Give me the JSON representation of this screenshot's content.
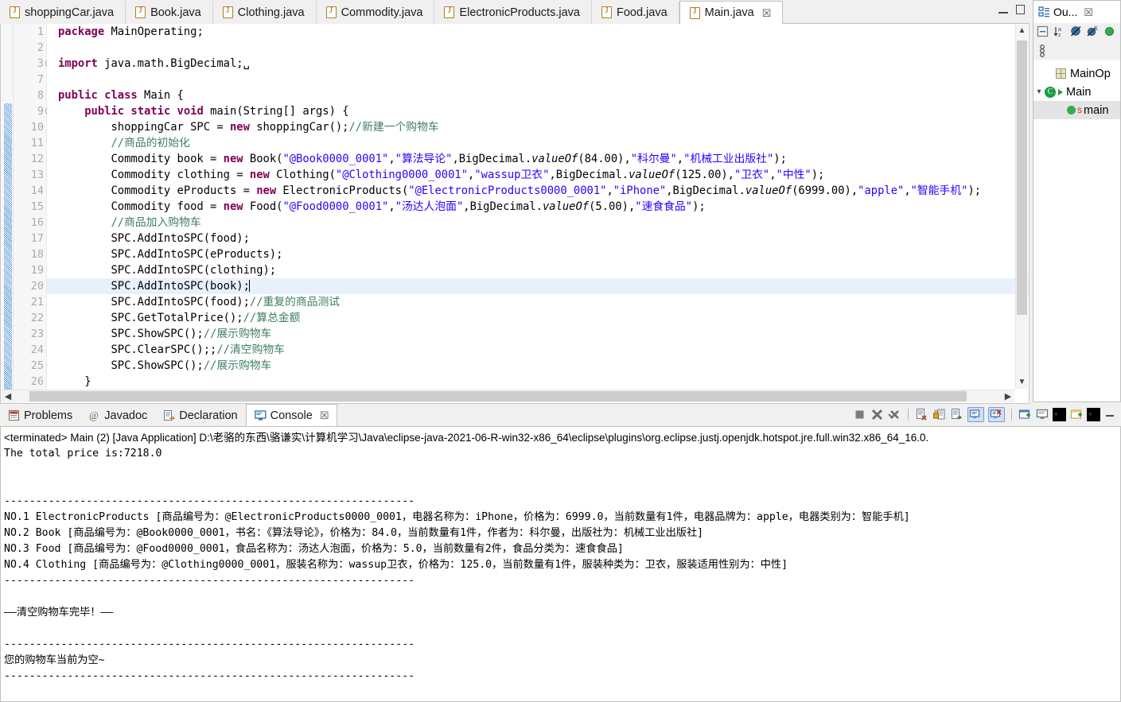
{
  "editor": {
    "tabs": [
      {
        "label": "shoppingCar.java",
        "active": false,
        "closable": false
      },
      {
        "label": "Book.java",
        "active": false,
        "closable": false
      },
      {
        "label": "Clothing.java",
        "active": false,
        "closable": false
      },
      {
        "label": "Commodity.java",
        "active": false,
        "closable": false
      },
      {
        "label": "ElectronicProducts.java",
        "active": false,
        "closable": false
      },
      {
        "label": "Food.java",
        "active": false,
        "closable": false
      },
      {
        "label": "Main.java",
        "active": true,
        "closable": true
      }
    ],
    "close_glyph": "☒",
    "minimize_tooltip": "Minimize",
    "maximize_tooltip": "Maximize",
    "line_numbers": [
      "1",
      "2",
      "3",
      "7",
      "8",
      "9",
      "10",
      "11",
      "12",
      "13",
      "14",
      "15",
      "16",
      "17",
      "18",
      "19",
      "20",
      "21",
      "22",
      "23",
      "24",
      "25",
      "26"
    ],
    "current_line": "20",
    "code": [
      {
        "n": "1",
        "fold": "",
        "html": "<span class=\"kw\">package</span> MainOperating;"
      },
      {
        "n": "2",
        "fold": "",
        "html": ""
      },
      {
        "n": "3",
        "fold": "plus",
        "html": "<span class=\"kw\">import</span> java.math.BigDecimal;␣"
      },
      {
        "n": "7",
        "fold": "",
        "html": ""
      },
      {
        "n": "8",
        "fold": "",
        "html": "<span class=\"kw\">public</span> <span class=\"kw\">class</span> Main {"
      },
      {
        "n": "9",
        "fold": "minus",
        "html": "    <span class=\"kw\">public</span> <span class=\"kw\">static</span> <span class=\"kw\">void</span> main(String[] args) {"
      },
      {
        "n": "10",
        "fold": "",
        "html": "        shoppingCar SPC = <span class=\"kw\">new</span> shoppingCar();<span class=\"cmt\">//新建一个购物车</span>"
      },
      {
        "n": "11",
        "fold": "",
        "html": "        <span class=\"cmt\">//商品的初始化</span>"
      },
      {
        "n": "12",
        "fold": "",
        "html": "        Commodity book = <span class=\"kw\">new</span> Book(<span class=\"str\">\"@Book0000_0001\"</span>,<span class=\"str\">\"算法导论\"</span>,BigDecimal.<span class=\"ital\">valueOf</span>(84.00),<span class=\"str\">\"科尔曼\"</span>,<span class=\"str\">\"机械工业出版社\"</span>);"
      },
      {
        "n": "13",
        "fold": "",
        "html": "        Commodity clothing = <span class=\"kw\">new</span> Clothing(<span class=\"str\">\"@Clothing0000_0001\"</span>,<span class=\"str\">\"wassup卫衣\"</span>,BigDecimal.<span class=\"ital\">valueOf</span>(125.00),<span class=\"str\">\"卫衣\"</span>,<span class=\"str\">\"中性\"</span>);"
      },
      {
        "n": "14",
        "fold": "",
        "html": "        Commodity eProducts = <span class=\"kw\">new</span> ElectronicProducts(<span class=\"str\">\"@ElectronicProducts0000_0001\"</span>,<span class=\"str\">\"iPhone\"</span>,BigDecimal.<span class=\"ital\">valueOf</span>(6999.00),<span class=\"str\">\"apple\"</span>,<span class=\"str\">\"智能手机\"</span>);"
      },
      {
        "n": "15",
        "fold": "",
        "html": "        Commodity food = <span class=\"kw\">new</span> Food(<span class=\"str\">\"@Food0000_0001\"</span>,<span class=\"str\">\"汤达人泡面\"</span>,BigDecimal.<span class=\"ital\">valueOf</span>(5.00),<span class=\"str\">\"速食食品\"</span>);"
      },
      {
        "n": "16",
        "fold": "",
        "html": "        <span class=\"cmt\">//商品加入购物车</span>"
      },
      {
        "n": "17",
        "fold": "",
        "html": "        SPC.AddIntoSPC(food);"
      },
      {
        "n": "18",
        "fold": "",
        "html": "        SPC.AddIntoSPC(eProducts);"
      },
      {
        "n": "19",
        "fold": "",
        "html": "        SPC.AddIntoSPC(clothing);"
      },
      {
        "n": "20",
        "fold": "",
        "html": "        SPC.AddIntoSPC(book);<span class=\"caret\"></span>"
      },
      {
        "n": "21",
        "fold": "",
        "html": "        SPC.AddIntoSPC(food);<span class=\"cmt\">//重复的商品测试</span>"
      },
      {
        "n": "22",
        "fold": "",
        "html": "        SPC.GetTotalPrice();<span class=\"cmt\">//算总金额</span>"
      },
      {
        "n": "23",
        "fold": "",
        "html": "        SPC.ShowSPC();<span class=\"cmt\">//展示购物车</span>"
      },
      {
        "n": "24",
        "fold": "",
        "html": "        SPC.ClearSPC();;<span class=\"cmt\">//清空购物车</span>"
      },
      {
        "n": "25",
        "fold": "",
        "html": "        SPC.ShowSPC();<span class=\"cmt\">//展示购物车</span>"
      },
      {
        "n": "26",
        "fold": "",
        "html": "    }"
      }
    ]
  },
  "outline": {
    "title": "Ou...",
    "close_glyph": "☒",
    "toolbar_icons": [
      "collapse-all-icon",
      "sort-icon",
      "hide-fields-icon",
      "hide-static-icon",
      "hide-nonpublic-icon",
      "link-icon"
    ],
    "items": [
      {
        "label": "MainOp",
        "kind": "package",
        "indent": 1,
        "expandable": false,
        "selected": false
      },
      {
        "label": "Main",
        "kind": "class",
        "indent": 0,
        "expandable": true,
        "expanded": true,
        "selected": false
      },
      {
        "label": "main",
        "kind": "method",
        "indent": 2,
        "expandable": false,
        "selected": true,
        "modifier": "S"
      }
    ]
  },
  "bottom": {
    "tabs": [
      {
        "label": "Problems",
        "icon": "problems-icon",
        "active": false,
        "closable": false
      },
      {
        "label": "Javadoc",
        "icon": "javadoc-icon",
        "active": false,
        "closable": false
      },
      {
        "label": "Declaration",
        "icon": "declaration-icon",
        "active": false,
        "closable": false
      },
      {
        "label": "Console",
        "icon": "console-icon",
        "active": true,
        "closable": true
      }
    ],
    "close_glyph": "☒",
    "toolbar": [
      {
        "name": "terminate-button",
        "glyph": "■"
      },
      {
        "name": "remove-launch-button",
        "glyph": "✖"
      },
      {
        "name": "remove-all-terminated-button",
        "glyph": "✖"
      },
      {
        "name": "separator-1",
        "glyph": ""
      },
      {
        "name": "clear-console-button",
        "glyph": "⌧"
      },
      {
        "name": "scroll-lock-button",
        "glyph": "ὑ2"
      },
      {
        "name": "word-wrap-button",
        "glyph": "↵"
      },
      {
        "name": "show-console-on-output-button",
        "glyph": "⌨"
      },
      {
        "name": "show-console-on-error-button",
        "glyph": "⌨"
      },
      {
        "name": "separator-2",
        "glyph": ""
      },
      {
        "name": "pin-console-button",
        "glyph": "⧉"
      },
      {
        "name": "display-selected-console-button",
        "glyph": "▤"
      },
      {
        "name": "display-selected-console-dropdown",
        "glyph": "▾"
      },
      {
        "name": "open-console-button",
        "glyph": "▧"
      },
      {
        "name": "open-console-dropdown",
        "glyph": "▾"
      },
      {
        "name": "minimize-button",
        "glyph": "—"
      }
    ]
  },
  "console": {
    "launch_line": "<terminated> Main (2) [Java Application] D:\\老骆的东西\\骆谦实\\计算机学习\\Java\\eclipse-java-2021-06-R-win32-x86_64\\eclipse\\plugins\\org.eclipse.justj.openjdk.hotspot.jre.full.win32.x86_64_16.0.",
    "lines": [
      "The total price is:7218.0",
      "",
      "",
      "-----------------------------------------------------------------",
      "NO.1 ElectronicProducts [商品编号为：@ElectronicProducts0000_0001，电器名称为：iPhone，价格为：6999.0，当前数量有1件，电器品牌为：apple，电器类别为：智能手机]",
      "NO.2 Book [商品编号为：@Book0000_0001，书名：《算法导论》，价格为：84.0，当前数量有1件，作者为：科尔曼，出版社为：机械工业出版社]",
      "NO.3 Food [商品编号为：@Food0000_0001，食品名称为：汤达人泡面，价格为：5.0，当前数量有2件，食品分类为：速食食品]",
      "NO.4 Clothing [商品编号为：@Clothing0000_0001，服装名称为：wassup卫衣，价格为：125.0，当前数量有1件，服装种类为：卫衣，服装适用性别为：中性]",
      "-----------------------------------------------------------------",
      "",
      "——清空购物车完毕！——",
      "",
      "-----------------------------------------------------------------",
      "您的购物车当前为空~",
      "-----------------------------------------------------------------"
    ]
  },
  "colors": {
    "keyword": "#7f0055",
    "string": "#2a00ff",
    "comment": "#3f7f5f",
    "current_line_highlight": "#e8f1fb",
    "tab_active_bg": "#ffffff",
    "chrome_bg": "#f0f0f0"
  }
}
